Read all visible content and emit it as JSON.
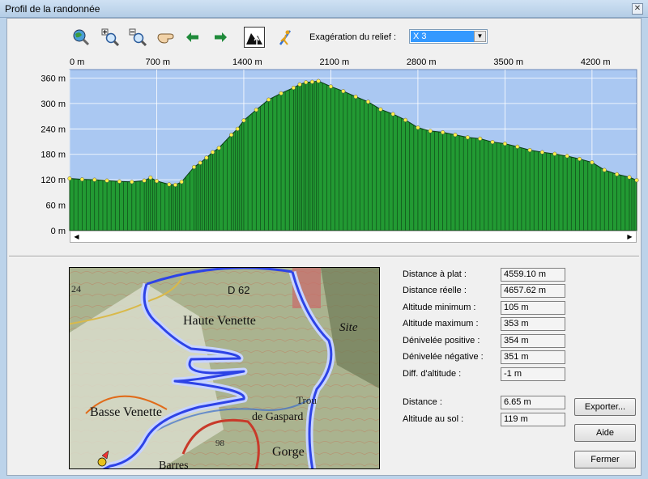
{
  "window": {
    "title": "Profil de la randonnée"
  },
  "toolbar": {
    "exaggeration_label": "Exagération du relief :",
    "exaggeration_value": "X 3"
  },
  "chart_data": {
    "type": "area",
    "x_ticks": [
      "0 m",
      "700 m",
      "1400 m",
      "2100 m",
      "2800 m",
      "3500 m",
      "4200 m"
    ],
    "y_ticks": [
      "0 m",
      "60 m",
      "120 m",
      "180 m",
      "240 m",
      "300 m",
      "360 m"
    ],
    "xlim": [
      0,
      4559
    ],
    "ylim": [
      0,
      380
    ],
    "grid": true,
    "series": [
      {
        "x": [
          0,
          100,
          200,
          300,
          400,
          500,
          600,
          650,
          700,
          800,
          850,
          900,
          1000,
          1050,
          1100,
          1150,
          1200,
          1300,
          1350,
          1400,
          1500,
          1600,
          1700,
          1800,
          1850,
          1900,
          1950,
          2000,
          2100,
          2200,
          2300,
          2400,
          2500,
          2600,
          2700,
          2800,
          2900,
          3000,
          3100,
          3200,
          3300,
          3400,
          3500,
          3600,
          3700,
          3800,
          3900,
          4000,
          4100,
          4200,
          4300,
          4400,
          4500,
          4559
        ],
        "y": [
          123,
          121,
          120,
          118,
          116,
          115,
          118,
          125,
          117,
          109,
          108,
          115,
          150,
          160,
          172,
          185,
          195,
          226,
          240,
          260,
          285,
          309,
          324,
          337,
          345,
          350,
          351,
          353,
          340,
          329,
          316,
          304,
          286,
          275,
          261,
          243,
          235,
          232,
          226,
          220,
          217,
          209,
          205,
          198,
          190,
          185,
          181,
          176,
          169,
          161,
          143,
          133,
          126,
          119
        ]
      }
    ]
  },
  "stats": [
    {
      "label": "Distance à plat :",
      "value": "4559.10 m"
    },
    {
      "label": "Distance réelle :",
      "value": "4657.62 m"
    },
    {
      "label": "Altitude minimum :",
      "value": "105 m"
    },
    {
      "label": "Altitude maximum :",
      "value": "353 m"
    },
    {
      "label": "Dénivelée positive :",
      "value": "354 m"
    },
    {
      "label": "Dénivelée négative :",
      "value": "351 m"
    },
    {
      "label": "Diff. d'altitude :",
      "value": "-1 m"
    }
  ],
  "cursor": [
    {
      "label": "Distance :",
      "value": "6.65 m"
    },
    {
      "label": "Altitude au sol :",
      "value": "119 m"
    }
  ],
  "buttons": {
    "export": "Exporter...",
    "help": "Aide",
    "close": "Fermer"
  },
  "map": {
    "labels": [
      "24",
      "D 62",
      "Haute Venette",
      "Basse Venette",
      "de Gaspard",
      "Trou",
      "Site",
      "Gorge",
      "Barres",
      "98"
    ]
  },
  "colors": {
    "fill": "#229a33",
    "sky": "#aac8f2",
    "point": "#fff04a",
    "track": "#2d43e6"
  }
}
